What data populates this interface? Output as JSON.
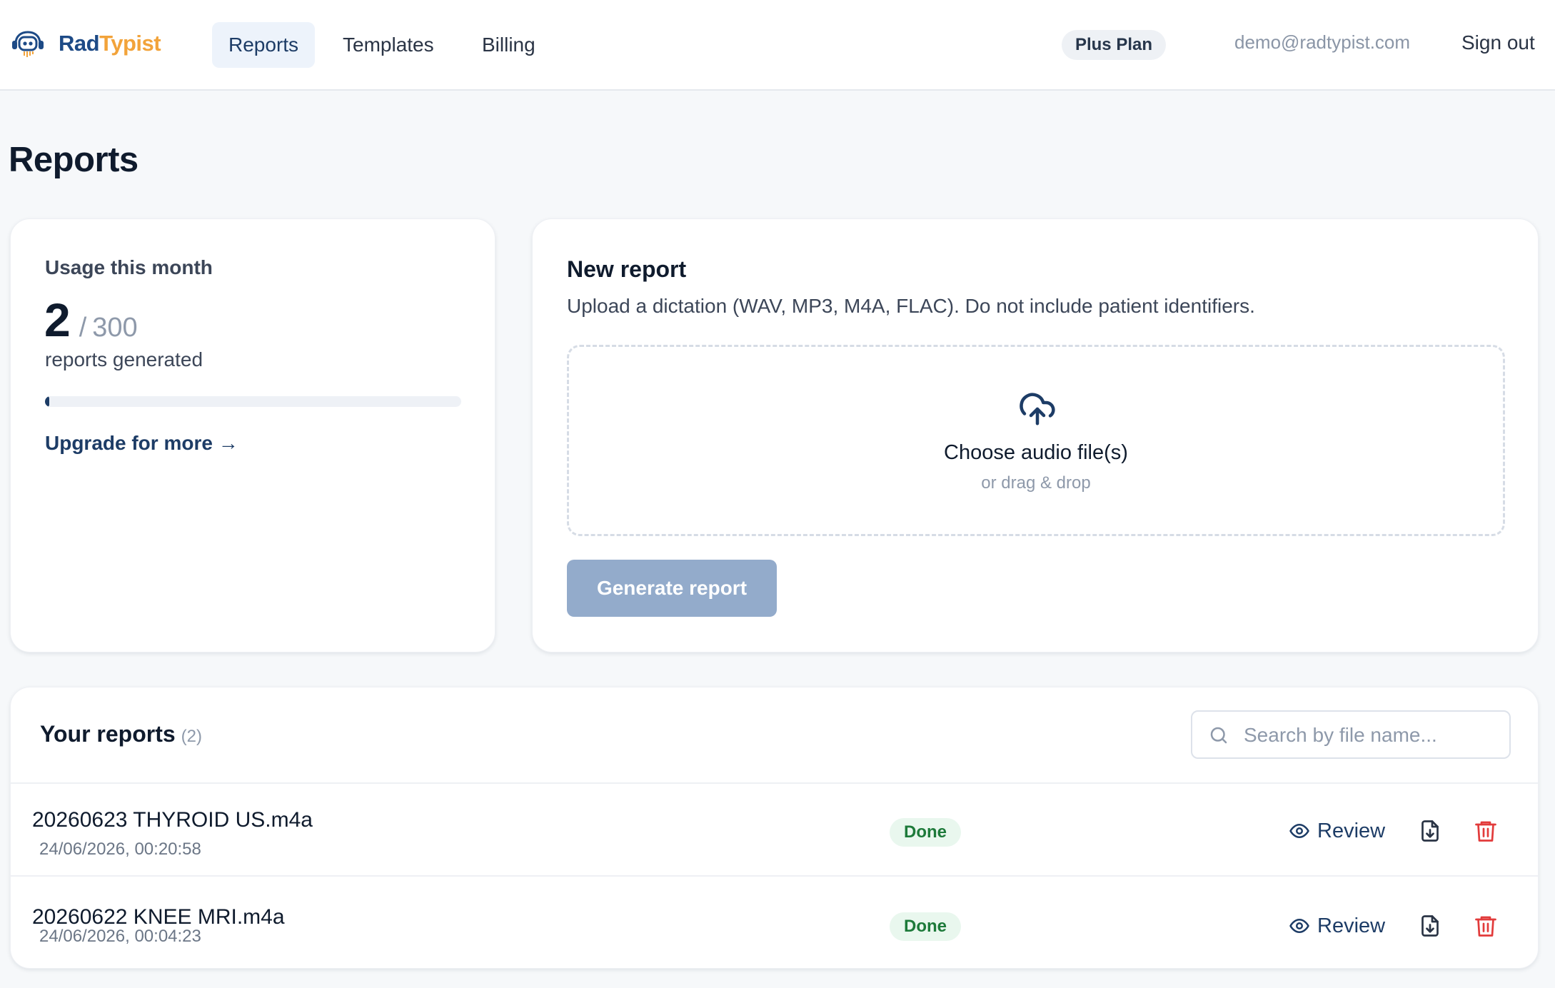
{
  "header": {
    "logo": {
      "rad": "Rad",
      "typist": "Typist",
      "icon": "robot-headset-icon"
    },
    "tabs": [
      {
        "label": "Reports",
        "active": true
      },
      {
        "label": "Templates",
        "active": false
      },
      {
        "label": "Billing",
        "active": false
      }
    ],
    "plan_badge": "Plus Plan",
    "user_email": "demo@radtypist.com",
    "sign_out": "Sign out"
  },
  "page": {
    "title": "Reports"
  },
  "usage": {
    "title": "Usage this month",
    "used": "2",
    "slash": "/",
    "total": "300",
    "subtitle": "reports generated",
    "progress_fraction": 0.0067,
    "upgrade_link": "Upgrade for more →"
  },
  "new_report": {
    "title": "New report",
    "description": "Upload a dictation (WAV, MP3, M4A, FLAC). Do not include patient identifiers.",
    "dropzone": {
      "icon": "cloud-upload-icon",
      "main": "Choose audio file(s)",
      "sub": "or drag & drop"
    },
    "generate_button": "Generate report"
  },
  "reports": {
    "title": "Your reports",
    "count": "(2)",
    "search": {
      "placeholder": "Search by file name...",
      "value": "",
      "icon": "search-icon"
    },
    "rows": [
      {
        "file_name": "20260623 THYROID US.m4a",
        "date": "24/06/2026, 00:20:58",
        "status": "Done",
        "review_label": "Review"
      },
      {
        "file_name": "20260622 KNEE MRI.m4a",
        "date": "24/06/2026, 00:04:23",
        "status": "Done",
        "review_label": "Review"
      }
    ]
  },
  "colors": {
    "brand_navy": "#1d3c66",
    "brand_orange": "#f2a33a",
    "status_done": "#1d7a3a",
    "delete_red": "#e23b3b",
    "button_disabled": "#93abcb"
  }
}
